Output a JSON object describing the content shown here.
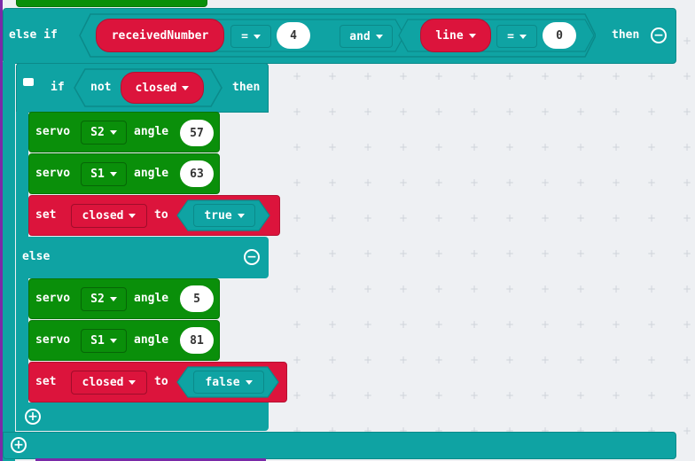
{
  "elseif": {
    "label": "else if",
    "var1": "receivedNumber",
    "op1": "=",
    "val1": "4",
    "conj": "and",
    "var2": "line",
    "op2": "=",
    "val2": "0",
    "then": "then"
  },
  "if_block": {
    "if_label": "if",
    "not_label": "not",
    "var": "closed",
    "then": "then",
    "else_label": "else"
  },
  "then_branch": [
    {
      "kw": "servo",
      "pin": "S2",
      "angle_label": "angle",
      "value": "57"
    },
    {
      "kw": "servo",
      "pin": "S1",
      "angle_label": "angle",
      "value": "63"
    }
  ],
  "set_then": {
    "kw": "set",
    "var": "closed",
    "to": "to",
    "value": "true"
  },
  "else_branch": [
    {
      "kw": "servo",
      "pin": "S2",
      "angle_label": "angle",
      "value": "5"
    },
    {
      "kw": "servo",
      "pin": "S1",
      "angle_label": "angle",
      "value": "81"
    }
  ],
  "set_else": {
    "kw": "set",
    "var": "closed",
    "to": "to",
    "value": "false"
  },
  "colors": {
    "logic": "#0fa3a3",
    "servo": "#0a8f0a",
    "variable": "#dc143c",
    "canvas": "#eef0f3"
  }
}
